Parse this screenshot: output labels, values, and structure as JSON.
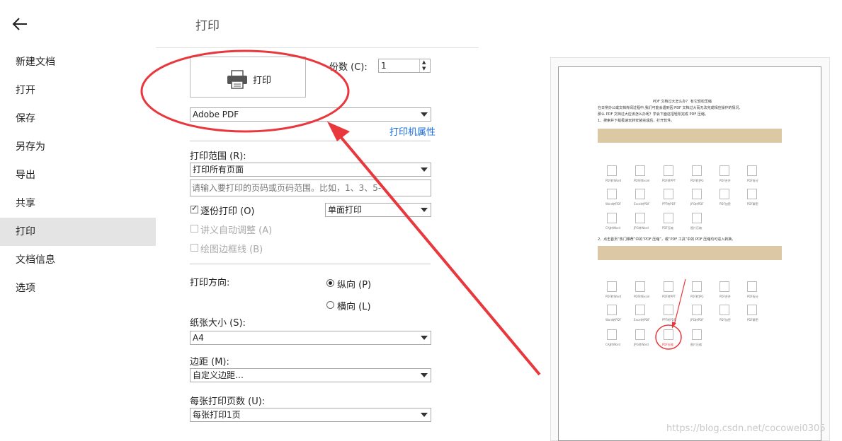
{
  "sidebar": {
    "items": [
      {
        "label": "新建文档"
      },
      {
        "label": "打开"
      },
      {
        "label": "保存"
      },
      {
        "label": "另存为"
      },
      {
        "label": "导出"
      },
      {
        "label": "共享"
      },
      {
        "label": "打印",
        "active": true
      },
      {
        "label": "文档信息"
      },
      {
        "label": "选项"
      }
    ]
  },
  "main": {
    "title": "打印",
    "print_button_label": "打印",
    "copies_label": "份数 (C):",
    "copies_value": "1",
    "printer_value": "Adobe PDF",
    "printer_properties_link": "打印机属性",
    "range_label": "打印范围 (R):",
    "range_value": "打印所有页面",
    "range_placeholder": "请输入要打印的页码或页码范围。比如，1、3、5-",
    "collate_label": "逐份打印 (O)",
    "duplex_value": "单面打印",
    "auto_fit_label": "讲义自动调整 (A)",
    "frame_label": "绘图边框线 (B)",
    "orientation_label": "打印方向:",
    "portrait_label": "纵向 (P)",
    "landscape_label": "横向 (L)",
    "paper_size_label": "纸张大小 (S):",
    "paper_size_value": "A4",
    "margin_label": "边距 (M):",
    "margin_value": "自定义边距…",
    "pages_per_sheet_label": "每张打印页数 (U):",
    "pages_per_sheet_value": "每张打印1页"
  },
  "preview": {
    "doc_title": "PDF 文档过大怎么办？ 有它轻松压缩",
    "lines": [
      "在日常办公或文档传阅过程中,我们可能会遇到因 PDF 文档过大而无法完成相应操作的情况,",
      "那么 PDF 文档过大应该怎么办呢？学会下面这招轻松完成 PDF 压缩。",
      "1、搜索并下载极速玩转安装完成后，打开软件。"
    ],
    "step2": "2、点击首页“热门推荐”中的“PDF 压缩”，或“PDF 工具”中的 PDF 压缩均可进入转换。",
    "shot_icons": [
      "PDF转Word",
      "PDF转Excel",
      "PDF转PPT",
      "PDF转JPG",
      "PDF合并",
      "PDF拆分",
      "Word转PDF",
      "Excel转PDF",
      "PPT转PDF",
      "JPG转PDF",
      "PDF加密",
      "PDF解密",
      "CAJ转Word",
      "JPG转Word",
      "PDF压缩",
      "图片压缩"
    ]
  },
  "watermark": "https://blog.csdn.net/cocowei0305",
  "colors": {
    "annotation": "#e8383d",
    "link": "#1a6ed8",
    "active_nav": "#e4e4e4"
  }
}
